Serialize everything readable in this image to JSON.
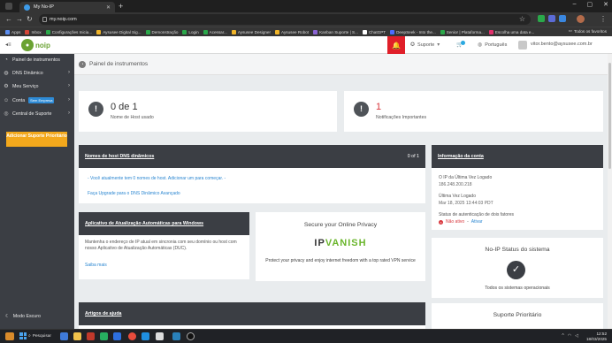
{
  "browser": {
    "tab_title": "My No-IP",
    "url": "my.noip.com",
    "bookmarks": [
      {
        "label": "Apps",
        "color": "#5b8def"
      },
      {
        "label": "Inbox",
        "color": "#d44638"
      },
      {
        "label": "Configurações Inicia...",
        "color": "#2aa84a"
      },
      {
        "label": "Aysusee Digital Sig...",
        "color": "#f0b429"
      },
      {
        "label": "Demonstração",
        "color": "#2aa84a"
      },
      {
        "label": "Login",
        "color": "#2aa84a"
      },
      {
        "label": "Acessar...",
        "color": "#2aa84a"
      },
      {
        "label": "Aysusee Designer",
        "color": "#f0b429"
      },
      {
        "label": "Aysusee Robot",
        "color": "#f0b429"
      },
      {
        "label": "Kanban Suporte | S...",
        "color": "#8a63d2"
      },
      {
        "label": "ChatGPT",
        "color": "#ffffff"
      },
      {
        "label": "DeepSeek - Into the...",
        "color": "#4d6bfe"
      },
      {
        "label": "Senior | Plataforma...",
        "color": "#2aa84a"
      },
      {
        "label": "Escolha uma data e...",
        "color": "#e1306c"
      }
    ],
    "all_bookmarks": "Todos os favoritos"
  },
  "header": {
    "logo_text": "noip",
    "support": "Suporte",
    "language": "Português",
    "user_email": "vitor.bento@aysusee.com.br"
  },
  "sidebar": {
    "items": [
      {
        "label": "Painel de instrumentos",
        "icon": "dashboard-icon",
        "badge": "",
        "chevron": false
      },
      {
        "label": "DNS Dinâmico",
        "icon": "globe-icon",
        "badge": "",
        "chevron": true
      },
      {
        "label": "Meu Serviço",
        "icon": "gear-icon",
        "badge": "",
        "chevron": true
      },
      {
        "label": "Conta",
        "icon": "user-icon",
        "badge": "Sem Empresa",
        "chevron": true
      },
      {
        "label": "Central de Suporte",
        "icon": "lifebuoy-icon",
        "badge": "",
        "chevron": true
      }
    ],
    "upgrade_label": "Adicionar Suporte Prioritário",
    "dark_mode_label": "Modo Escuro"
  },
  "page": {
    "title": "Painel de instrumentos"
  },
  "stats": [
    {
      "value": "0 de 1",
      "label": "Nome de Host usado",
      "color": "#333333"
    },
    {
      "value": "1",
      "label": "Notificações Importantes",
      "color": "#d8353b"
    }
  ],
  "dns_card": {
    "title": "Nomes de host DNS dinâmicos",
    "count": "0 of 1",
    "empty_msg": "- Você atualmente tem 0 nomes de host. Adicionar um para começar. -",
    "upgrade_link": "Faça Upgrade para o DNS Dinâmico Avançado"
  },
  "account_card": {
    "title": "Informação da conta",
    "ip_label": "O IP da Última Vez Logado",
    "ip_value": "186.248.200.218",
    "last_login_label": "Última Vez Logado",
    "last_login_value": "Mar 18, 2025 13:44:03 PDT",
    "two_factor_label": "Status de autenticação de dois fatores",
    "two_factor_status": "Não ativo",
    "two_factor_action": "Ativar"
  },
  "duc_card": {
    "title": "Aplicativo de Atualização Automáticas para Windows",
    "description": "Mantenha o endereço de IP atual em sincronia com seu domínio ou host com nosso Aplicativo de Atualização Automáticas (DUC).",
    "more_link": "Saiba mais"
  },
  "ad_card": {
    "title": "Secure your Online Privacy",
    "brand_a": "IP",
    "brand_b": "VANISH",
    "text": "Protect your privacy and enjoy internet freedom with a top rated VPN service"
  },
  "status_card": {
    "title": "No-IP Status do sistema",
    "status_text": "Todos os sistemas operacionais"
  },
  "help_card": {
    "title": "Artigos de ajuda"
  },
  "priority_card": {
    "title": "Suporte Prioritário"
  },
  "taskbar": {
    "search_label": "Pesquisar",
    "time": "12:52",
    "date": "18/03/2025"
  }
}
